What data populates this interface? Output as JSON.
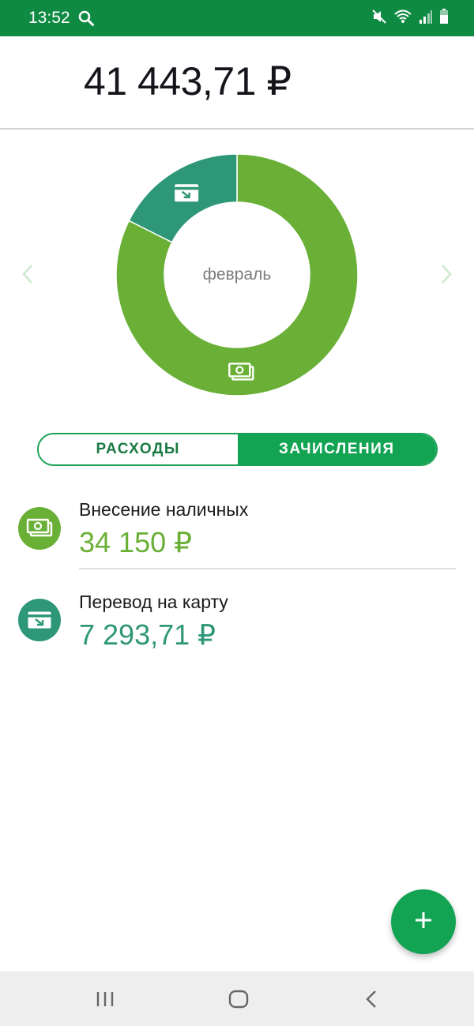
{
  "status_bar": {
    "time": "13:52",
    "background": "#0e8a43",
    "icons": [
      "search-icon",
      "mute-icon",
      "wifi-icon",
      "signal-icon",
      "battery-icon"
    ]
  },
  "balance": {
    "value": "41 443,71 ₽"
  },
  "chart": {
    "month": "февраль",
    "prev_icon": "chevron-left-icon",
    "next_icon": "chevron-right-icon"
  },
  "chart_data": {
    "type": "pie",
    "center_label": "февраль",
    "slices": [
      {
        "name": "Внесение наличных",
        "value": 34150,
        "color": "#6ab036",
        "icon": "cash-icon"
      },
      {
        "name": "Перевод на карту",
        "value": 7293.71,
        "color": "#2e9777",
        "icon": "card-transfer-icon"
      }
    ]
  },
  "tabs": {
    "expenses": "РАСХОДЫ",
    "income": "ЗАЧИСЛЕНИЯ",
    "active": "income"
  },
  "items": [
    {
      "title": "Внесение наличных",
      "amount": "34 150 ₽",
      "icon": "cash-icon",
      "color": "#6ab036"
    },
    {
      "title": "Перевод на карту",
      "amount": "7 293,71 ₽",
      "icon": "card-transfer-icon",
      "color": "#2e9777"
    }
  ],
  "fab": {
    "icon": "plus-icon"
  },
  "nav_bar": {
    "icons": [
      "recents-icon",
      "home-icon",
      "back-icon"
    ]
  },
  "colors": {
    "accent": "#12a353",
    "cash": "#6ab036",
    "transfer": "#2e9777"
  }
}
